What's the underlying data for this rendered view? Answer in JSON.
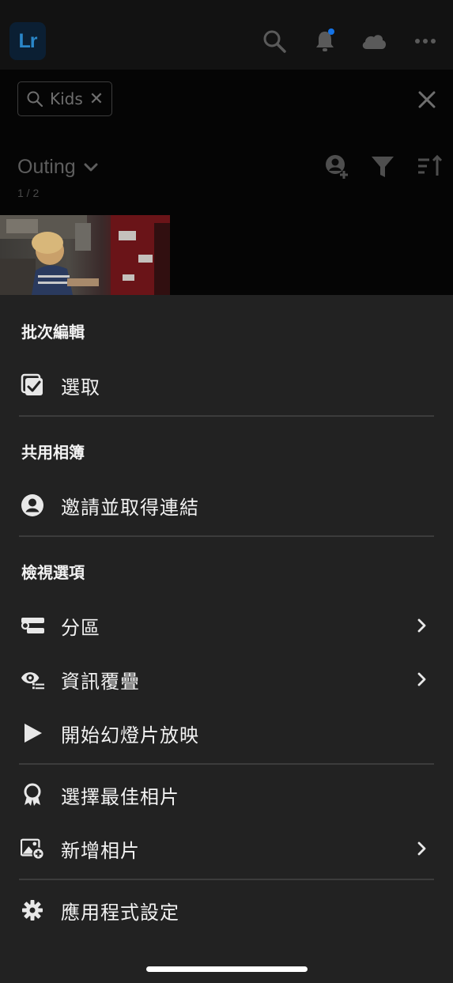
{
  "app": {
    "logo_text": "Lr"
  },
  "topbar": {
    "icons": [
      "search-icon",
      "bell-icon",
      "cloud-icon",
      "more-icon"
    ],
    "notification_dot_color": "#1473e6"
  },
  "search": {
    "chip_text": "Kids"
  },
  "album": {
    "title": "Outing",
    "count": "1 / 2"
  },
  "sheet": {
    "sections": [
      {
        "title": "批次編輯",
        "items": [
          {
            "label": "選取",
            "icon": "select-checkbox-icon"
          }
        ]
      },
      {
        "title": "共用相簿",
        "items": [
          {
            "label": "邀請並取得連結",
            "icon": "person-circle-icon"
          }
        ]
      },
      {
        "title": "檢視選項",
        "items": [
          {
            "label": "分區",
            "icon": "segment-icon",
            "chevron": true
          },
          {
            "label": "資訊覆疊",
            "icon": "eye-info-icon",
            "chevron": true
          },
          {
            "label": "開始幻燈片放映",
            "icon": "play-icon"
          }
        ]
      },
      {
        "title": "",
        "items": [
          {
            "label": "選擇最佳相片",
            "icon": "award-ribbon-icon"
          },
          {
            "label": "新增相片",
            "icon": "add-photo-icon",
            "chevron": true
          }
        ]
      },
      {
        "title": "",
        "items": [
          {
            "label": "應用程式設定",
            "icon": "gear-icon"
          }
        ]
      }
    ]
  },
  "colors": {
    "sheet_bg": "#222222",
    "accent": "#1473e6"
  }
}
